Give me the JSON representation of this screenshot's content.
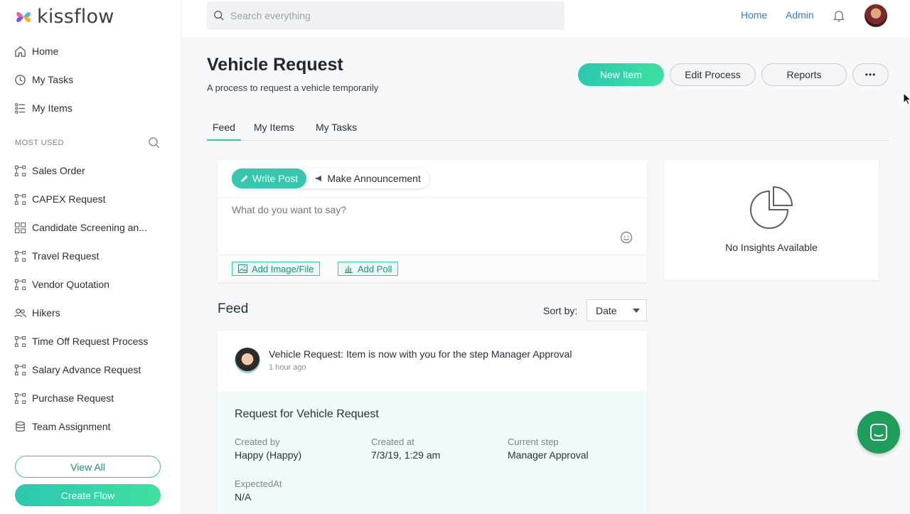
{
  "brand": {
    "name": "kissflow"
  },
  "sidebar": {
    "nav": [
      {
        "label": "Home",
        "icon": "home-icon"
      },
      {
        "label": "My Tasks",
        "icon": "clock-icon"
      },
      {
        "label": "My Items",
        "icon": "list-icon"
      }
    ],
    "section_label": "MOST USED",
    "most_used": [
      {
        "label": "Sales Order",
        "icon": "process-icon"
      },
      {
        "label": "CAPEX Request",
        "icon": "process-icon"
      },
      {
        "label": "Candidate Screening an...",
        "icon": "grid-icon"
      },
      {
        "label": "Travel Request",
        "icon": "process-icon"
      },
      {
        "label": "Vendor Quotation",
        "icon": "process-icon"
      },
      {
        "label": "Hikers",
        "icon": "people-icon"
      },
      {
        "label": "Time Off Request Process",
        "icon": "process-icon"
      },
      {
        "label": "Salary Advance Request",
        "icon": "process-icon"
      },
      {
        "label": "Purchase Request",
        "icon": "process-icon"
      },
      {
        "label": "Team Assignment",
        "icon": "database-icon"
      }
    ],
    "view_all": "View All",
    "create_flow": "Create Flow"
  },
  "topbar": {
    "search_placeholder": "Search everything",
    "home": "Home",
    "admin": "Admin"
  },
  "page": {
    "title": "Vehicle Request",
    "subtitle": "A process to request a vehicle temporarily",
    "new_item": "New Item",
    "edit_process": "Edit Process",
    "reports": "Reports",
    "more": "•••",
    "tabs": [
      "Feed",
      "My Items",
      "My Tasks"
    ]
  },
  "post": {
    "write_post": "Write Post",
    "make_announcement": "Make Announcement",
    "placeholder": "What do you want to say?",
    "add_image": "Add Image/File",
    "add_poll": "Add Poll"
  },
  "insights": {
    "text": "No Insights Available"
  },
  "feed": {
    "title": "Feed",
    "sort_label": "Sort by:",
    "sort_value": "Date",
    "item": {
      "message": "Vehicle Request: Item is now with you for the step Manager Approval",
      "time": "1 hour ago",
      "detail_title": "Request for Vehicle Request",
      "fields": {
        "created_by_label": "Created by",
        "created_by": "Happy (Happy)",
        "created_at_label": "Created at",
        "created_at": "7/3/19, 1:29 am",
        "current_step_label": "Current step",
        "current_step": "Manager Approval",
        "expected_label": "ExpectedAt",
        "expected": "N/A"
      }
    }
  },
  "colors": {
    "accent": "#2cc7a4",
    "link": "#2a7fd8",
    "chat": "#1f9d5b"
  }
}
